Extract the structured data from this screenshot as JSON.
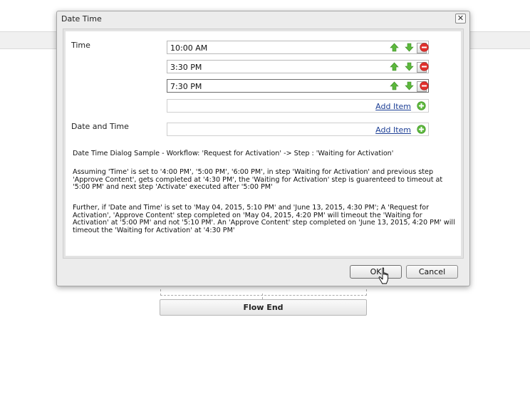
{
  "dialog": {
    "title": "Date Time",
    "close_symbol": "✕",
    "time_label": "Time",
    "date_time_label": "Date and Time",
    "time_values": [
      "10:00 AM",
      "3:30 PM",
      "7:30 PM"
    ],
    "add_item_label": "Add Item",
    "description": {
      "line1": "Date Time Dialog Sample - Workflow: 'Request for Activation' -> Step : 'Waiting for Activation'",
      "para2": "Assuming 'Time' is set to '4:00 PM', '5:00 PM', '6:00 PM', in step 'Waiting for Activation' and previous step 'Approve Content', gets completed at '4:30 PM', the 'Waiting for Activation' step is guarenteed to timeout at '5:00 PM' and next step 'Activate' executed after '5:00 PM'",
      "para3": "Further, if 'Date and Time' is set to 'May 04, 2015, 5:10 PM' and 'June 13, 2015, 4:30 PM'; A 'Request for Activation', 'Approve Content' step completed on 'May 04, 2015, 4:20 PM' will timeout the 'Waiting for Activation' at '5:00 PM' and not '5:10 PM'. An 'Approve Content' step completed on 'June 13, 2015, 4:20 PM' will timeout the 'Waiting for Activation' at '4:30 PM'"
    },
    "ok_label": "OK",
    "cancel_label": "Cancel"
  },
  "background": {
    "flow_end_label": "Flow End"
  },
  "icons": {
    "move_up": "arrow-up-icon",
    "move_down": "arrow-down-icon",
    "remove": "remove-icon",
    "add": "add-icon",
    "cursor": "hand-cursor-icon"
  },
  "colors": {
    "arrow_green": "#5cb83c",
    "remove_red": "#e0302c",
    "link_blue": "#1d3f95"
  }
}
